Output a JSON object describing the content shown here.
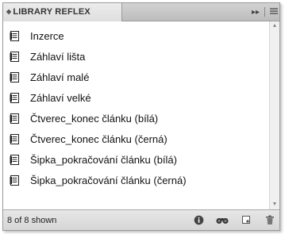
{
  "panel": {
    "title": "LIBRARY REFLEX",
    "menu_glyph": "▸▸"
  },
  "items": [
    {
      "label": "Inzerce"
    },
    {
      "label": "Záhlaví lišta"
    },
    {
      "label": "Záhlaví malé"
    },
    {
      "label": "Záhlaví velké"
    },
    {
      "label": "Čtverec_konec článku (bílá)"
    },
    {
      "label": "Čtverec_konec článku (černá)"
    },
    {
      "label": "Šipka_pokračování článku (bílá)"
    },
    {
      "label": "Šipka_pokračování článku (černá)"
    }
  ],
  "footer": {
    "status": "8 of 8 shown",
    "icons": [
      "info-icon",
      "search-binoculars-icon",
      "new-item-icon",
      "delete-icon"
    ]
  }
}
